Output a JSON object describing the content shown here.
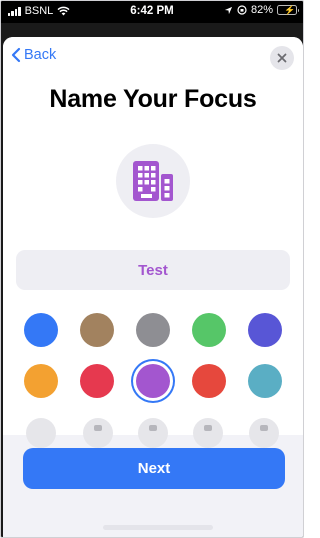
{
  "status_bar": {
    "carrier": "BSNL",
    "time": "6:42 PM",
    "battery": "82%",
    "battery_level": 0.82
  },
  "header": {
    "back_label": "Back",
    "close_icon": "close-icon"
  },
  "title": "Name Your Focus",
  "focus_icon": {
    "name": "building-icon",
    "color": "#a356cf"
  },
  "name_field": {
    "value": "Test",
    "color": "#a356cf"
  },
  "colors": {
    "row1": [
      "#3478f6",
      "#a2825f",
      "#8e8e93",
      "#56c668",
      "#5856d6"
    ],
    "row2": [
      "#f3a131",
      "#e6394f",
      "#a356cf",
      "#e6483d",
      "#5aaec4"
    ],
    "selected": "#a356cf"
  },
  "next_label": "Next",
  "accent": "#3478f6"
}
